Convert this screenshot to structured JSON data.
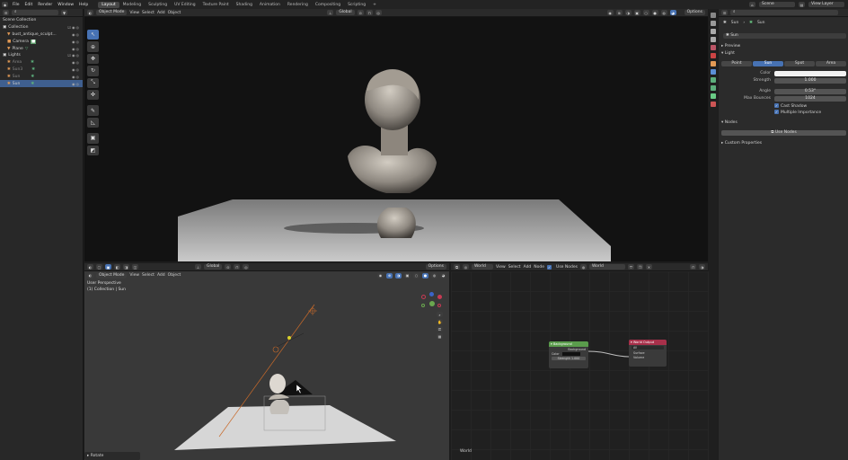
{
  "topbar": {
    "menus": [
      "File",
      "Edit",
      "Render",
      "Window",
      "Help"
    ],
    "workspaces": [
      "Layout",
      "Modeling",
      "Sculpting",
      "UV Editing",
      "Texture Paint",
      "Shading",
      "Animation",
      "Rendering",
      "Compositing",
      "Scripting",
      "+"
    ],
    "active_workspace": "Layout",
    "scene": "Scene",
    "view_layer": "View Layer"
  },
  "outliner": {
    "title": "Scene Collection",
    "items": [
      {
        "label": "Collection",
        "depth": 0
      },
      {
        "label": "bust_antique_sculpt...",
        "depth": 1
      },
      {
        "label": "Camera",
        "depth": 1
      },
      {
        "label": "Plane",
        "depth": 1
      },
      {
        "label": "Lights",
        "depth": 0
      },
      {
        "label": "Area",
        "depth": 1
      },
      {
        "label": "Sun3",
        "depth": 1
      },
      {
        "label": "Sun",
        "depth": 1
      },
      {
        "label": "Sun",
        "depth": 1
      }
    ]
  },
  "render_view": {
    "header_items": [
      "Object Mode",
      "View",
      "Select",
      "Add",
      "Object"
    ],
    "orientation": "Global",
    "options": "Options"
  },
  "viewport3d": {
    "header_items": [
      "Object Mode",
      "View",
      "Select",
      "Add",
      "Object"
    ],
    "orientation": "Global",
    "options": "Options",
    "overlay_line1": "User Perspective",
    "overlay_line2": "(1) Collection | Sun",
    "footer": "Rotate"
  },
  "node_editor": {
    "header_items": [
      "World",
      "View",
      "Select",
      "Add",
      "Node"
    ],
    "use_nodes": "Use Nodes",
    "world_name": "World",
    "footer_label": "World",
    "background_node": {
      "title": "Background",
      "output": "Background",
      "color_label": "Color",
      "strength_label": "Strength",
      "strength_value": "1.000"
    },
    "output_node": {
      "title": "World Output",
      "target": "All",
      "surface": "Surface",
      "volume": "Volume"
    }
  },
  "properties": {
    "object_name": "Sun",
    "data_name": "Sun",
    "search_placeholder": "Sun",
    "sections": {
      "preview": "Preview",
      "light": "Light",
      "nodes": "Nodes",
      "custom": "Custom Properties"
    },
    "light_types": [
      "Point",
      "Sun",
      "Spot",
      "Area"
    ],
    "active_light_type": "Sun",
    "fields": [
      {
        "label": "Color",
        "value": ""
      },
      {
        "label": "Strength",
        "value": "1.000"
      },
      {
        "label": "Angle",
        "value": "0.53°"
      },
      {
        "label": "Max Bounces",
        "value": "1024"
      }
    ],
    "cast_shadow": "Cast Shadow",
    "multiple_importance": "Multiple Importance",
    "use_nodes_button": "Use Nodes"
  },
  "colors": {
    "accent": "#4772b3",
    "node_background": "#5a9c4c",
    "node_output": "#a8304a"
  }
}
